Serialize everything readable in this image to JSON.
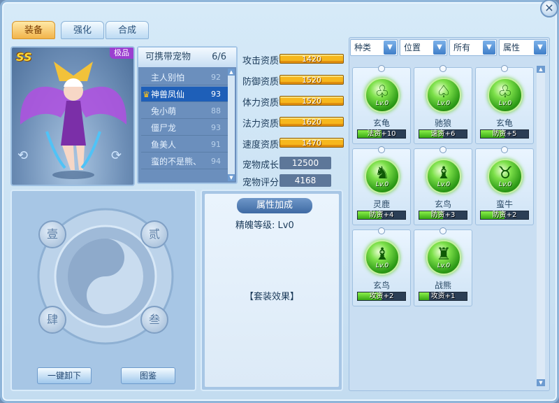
{
  "window": {
    "close_icon": "close-icon"
  },
  "tabs": [
    {
      "label": "装备",
      "active": true
    },
    {
      "label": "强化",
      "active": false
    },
    {
      "label": "合成",
      "active": false
    }
  ],
  "portrait": {
    "rank": "SS",
    "grade_badge": "极品"
  },
  "pet_list": {
    "header": "可携带宠物",
    "count": "6/6",
    "pets": [
      {
        "name": "主人别怕",
        "level": "92",
        "selected": false
      },
      {
        "name": "神兽凤仙",
        "level": "93",
        "selected": true
      },
      {
        "name": "兔小萌",
        "level": "88",
        "selected": false
      },
      {
        "name": "僵尸龙",
        "level": "93",
        "selected": false
      },
      {
        "name": "鱼美人",
        "level": "91",
        "selected": false
      },
      {
        "name": "蛮的不是熊、",
        "level": "94",
        "selected": false
      }
    ]
  },
  "stats": {
    "aptitudes": [
      {
        "label": "攻击资质",
        "value": "1420"
      },
      {
        "label": "防御资质",
        "value": "1520"
      },
      {
        "label": "体力资质",
        "value": "1520"
      },
      {
        "label": "法力资质",
        "value": "1620"
      },
      {
        "label": "速度资质",
        "value": "1470"
      }
    ],
    "growth_label": "宠物成长",
    "growth_value": "12500",
    "score_label": "宠物评分",
    "score_value": "4168"
  },
  "seals": {
    "tl": "壹",
    "tr": "贰",
    "bl": "肆",
    "br": "叁"
  },
  "buttons": {
    "unequip_all": "一键卸下",
    "catalog": "图鉴"
  },
  "attribute_panel": {
    "title": "属性加成",
    "essence_level": "精魄等级: Lv0",
    "set_effect": "【套装效果】"
  },
  "filters": [
    {
      "label": "种类"
    },
    {
      "label": "位置"
    },
    {
      "label": "所有"
    },
    {
      "label": "属性"
    }
  ],
  "items": [
    {
      "name": "玄龟",
      "level": "Lv.0",
      "bonus": "法资+10",
      "fill": 0.5
    },
    {
      "name": "驰狼",
      "level": "Lv.0",
      "bonus": "速资+6",
      "fill": 0.5
    },
    {
      "name": "玄龟",
      "level": "Lv.0",
      "bonus": "防资+5",
      "fill": 0.5
    },
    {
      "name": "灵鹿",
      "level": "Lv.0",
      "bonus": "防资+4",
      "fill": 0.5
    },
    {
      "name": "玄鸟",
      "level": "Lv.0",
      "bonus": "防资+3",
      "fill": 0.5
    },
    {
      "name": "蛮牛",
      "level": "Lv.0",
      "bonus": "防资+2",
      "fill": 0.5
    },
    {
      "name": "玄鸟",
      "level": "Lv.0",
      "bonus": "攻资+2",
      "fill": 0.5
    },
    {
      "name": "战熊",
      "level": "Lv.0",
      "bonus": "攻资+1",
      "fill": 0.2
    }
  ]
}
